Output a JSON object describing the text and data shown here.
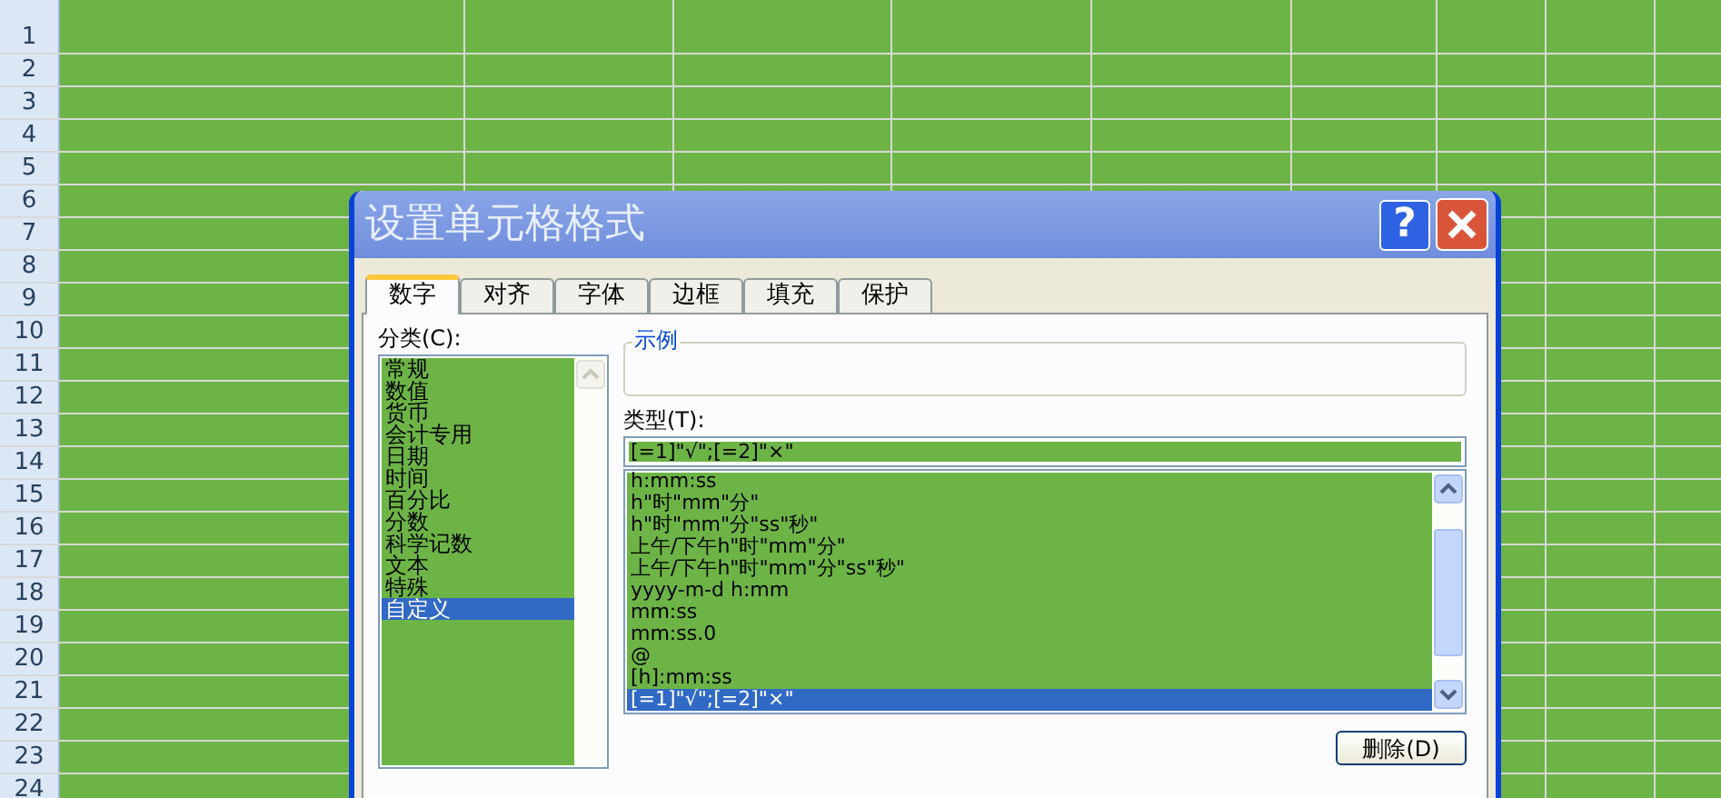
{
  "sheet": {
    "row_numbers": [
      "1",
      "2",
      "3",
      "4",
      "5",
      "6",
      "7",
      "8",
      "9",
      "10",
      "11",
      "12",
      "13",
      "14",
      "15",
      "16",
      "17",
      "18",
      "19",
      "20",
      "21",
      "22",
      "23",
      "24"
    ]
  },
  "dialog": {
    "title": "设置单元格格式",
    "help_button": "?",
    "tabs": [
      {
        "label": "数字",
        "selected": true
      },
      {
        "label": "对齐",
        "selected": false
      },
      {
        "label": "字体",
        "selected": false
      },
      {
        "label": "边框",
        "selected": false
      },
      {
        "label": "填充",
        "selected": false
      },
      {
        "label": "保护",
        "selected": false
      }
    ],
    "category_label": "分类(C):",
    "categories": [
      {
        "label": "常规",
        "selected": false
      },
      {
        "label": "数值",
        "selected": false
      },
      {
        "label": "货币",
        "selected": false
      },
      {
        "label": "会计专用",
        "selected": false
      },
      {
        "label": "日期",
        "selected": false
      },
      {
        "label": "时间",
        "selected": false
      },
      {
        "label": "百分比",
        "selected": false
      },
      {
        "label": "分数",
        "selected": false
      },
      {
        "label": "科学记数",
        "selected": false
      },
      {
        "label": "文本",
        "selected": false
      },
      {
        "label": "特殊",
        "selected": false
      },
      {
        "label": "自定义",
        "selected": true
      }
    ],
    "sample_label": "示例",
    "type_label": "类型(T):",
    "type_input": {
      "value": "[=1]\"√\";[=2]\"×\""
    },
    "type_list": [
      {
        "label": "h:mm:ss",
        "selected": false
      },
      {
        "label": "h\"时\"mm\"分\"",
        "selected": false
      },
      {
        "label": "h\"时\"mm\"分\"ss\"秒\"",
        "selected": false
      },
      {
        "label": "上午/下午h\"时\"mm\"分\"",
        "selected": false
      },
      {
        "label": "上午/下午h\"时\"mm\"分\"ss\"秒\"",
        "selected": false
      },
      {
        "label": "yyyy-m-d h:mm",
        "selected": false
      },
      {
        "label": "mm:ss",
        "selected": false
      },
      {
        "label": "mm:ss.0",
        "selected": false
      },
      {
        "label": "@",
        "selected": false
      },
      {
        "label": "[h]:mm:ss",
        "selected": false
      },
      {
        "label": "[=1]\"√\";[=2]\"×\"",
        "selected": true
      }
    ],
    "delete_button": "删除(D)"
  }
}
